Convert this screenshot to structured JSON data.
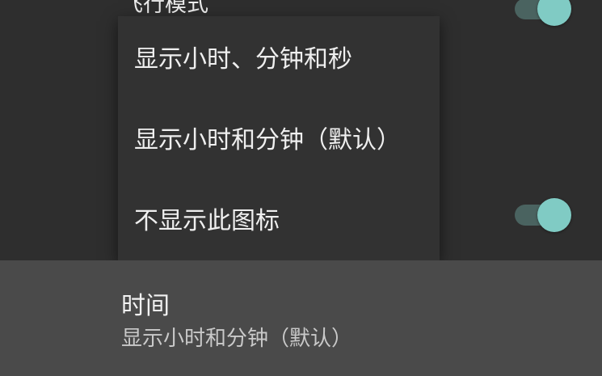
{
  "settings": {
    "airplane_mode_label": "飞行模式",
    "time": {
      "title": "时间",
      "summary": "显示小时和分钟（默认）"
    }
  },
  "popup": {
    "options": [
      "显示小时、分钟和秒",
      "显示小时和分钟（默认）",
      "不显示此图标"
    ]
  },
  "colors": {
    "toggle_thumb": "#80cbc4",
    "toggle_track": "#4a6360",
    "background": "#2e2e2e",
    "popup_background": "#323232",
    "highlight_row": "#4a4a4a"
  }
}
